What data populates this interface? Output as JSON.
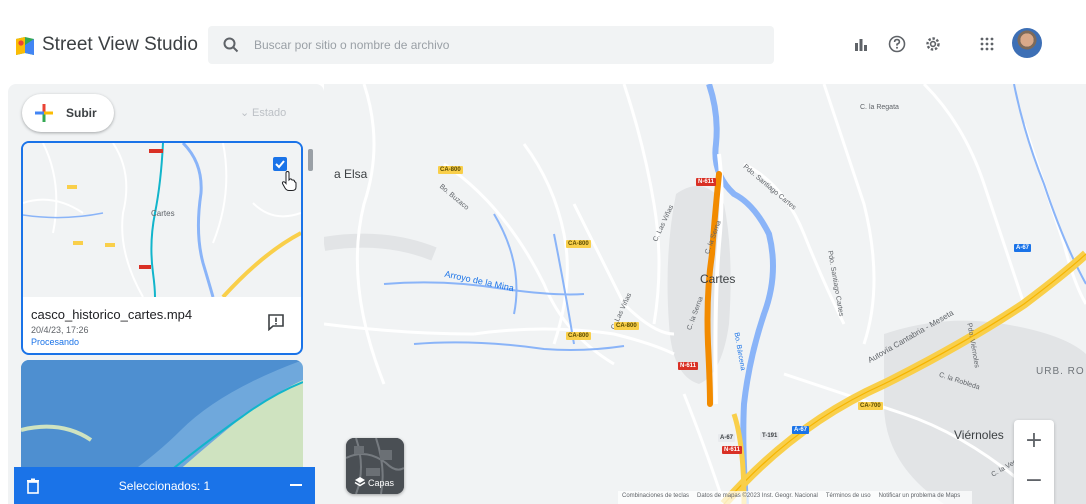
{
  "app": {
    "title": "Street View Studio"
  },
  "search": {
    "placeholder": "Buscar por sitio o nombre de archivo"
  },
  "toolbar": {
    "icons": [
      "bar-chart-icon",
      "help-icon",
      "settings-icon",
      "apps-grid-icon",
      "avatar"
    ]
  },
  "panel": {
    "upload_label": "Subir",
    "filter_label": "Estado",
    "items": [
      {
        "name": "casco_historico_cartes.mp4",
        "date": "20/4/23, 17:26",
        "status": "Procesando",
        "selected": true,
        "thumb_labels": [
          "Cartes"
        ]
      },
      {
        "name": "",
        "selected": false
      }
    ],
    "selection_label": "Seleccionados: 1"
  },
  "map": {
    "labels": {
      "elsa": "a Elsa",
      "cartes": "Cartes",
      "arroyo": "Arroyo de la Mina",
      "la_regata": "C. la Regata",
      "viernoles": "Viérnoles",
      "urb": "URB. RO",
      "autovia": "Autovía Cantabria - Meseta",
      "la_robleda": "C. la Robleda",
      "bo_buzaco": "Bo. Buzaco",
      "c_las_vinas1": "C. Las Viñas",
      "c_las_vinas2": "C. Las Viñas",
      "c_la_serna1": "C. la Serna",
      "c_la_serna2": "C. la Serna",
      "pdo_santiago_cartes": "Pdo. Santiago Cartes",
      "pdo_santiago_cartes2": "Pdo. Santiago Cartes",
      "bo_barcena": "Bo. Bárcena",
      "pdo_viernoles": "Pdo. Viérnoles",
      "c_la_vega": "C. la Vega"
    },
    "road_tags": {
      "ca800a": "CA-800",
      "ca800b": "CA-800",
      "ca800c": "CA-800",
      "ca800d": "CA-800",
      "n611a": "N-611",
      "n611b": "N-611",
      "n611c": "N-611",
      "a67a": "A-67",
      "a67b": "A-67",
      "a67c": "A-67",
      "ca700": "CA-700",
      "t191": "T-191"
    },
    "layers_label": "Capas",
    "zoom_in": "+",
    "zoom_out": "−",
    "footer": {
      "shortcuts": "Combinaciones de teclas",
      "data": "Datos de mapas ©2023 Inst. Geogr. Nacional",
      "terms": "Términos de uso",
      "report": "Notificar un problema de Maps"
    }
  },
  "colors": {
    "accent": "#1a73e8",
    "route": "#f28b00",
    "water": "#a8c7fa"
  }
}
